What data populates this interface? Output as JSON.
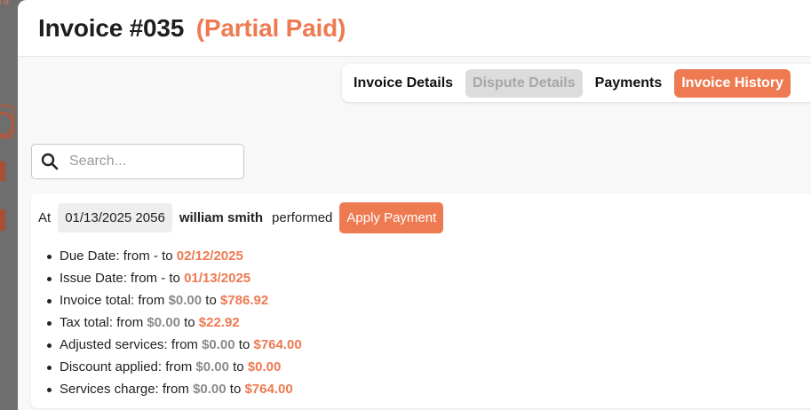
{
  "backdrop": {
    "fragment_text": "va"
  },
  "modal": {
    "title": "Invoice #035",
    "status": "(Partial Paid)"
  },
  "tabs": [
    {
      "label": "Invoice Details",
      "state": "normal"
    },
    {
      "label": "Dispute Details",
      "state": "disabled"
    },
    {
      "label": "Payments",
      "state": "normal"
    },
    {
      "label": "Invoice History",
      "state": "active"
    }
  ],
  "search": {
    "placeholder": "Search...",
    "value": "",
    "icon": "search-icon"
  },
  "history": {
    "entry": {
      "prefix": "At",
      "timestamp": "01/13/2025 2056",
      "user": "william smith",
      "verb": "performed",
      "action": "Apply Payment"
    },
    "changes": [
      {
        "field": "Due Date:",
        "from_word": "from",
        "from": "-",
        "to_word": "to",
        "to": "02/12/2025"
      },
      {
        "field": "Issue Date:",
        "from_word": "from",
        "from": "-",
        "to_word": "to",
        "to": "01/13/2025"
      },
      {
        "field": "Invoice total:",
        "from_word": "from",
        "from": "$0.00",
        "to_word": "to",
        "to": "$786.92"
      },
      {
        "field": "Tax total:",
        "from_word": "from",
        "from": "$0.00",
        "to_word": "to",
        "to": "$22.92"
      },
      {
        "field": "Adjusted services:",
        "from_word": "from",
        "from": "$0.00",
        "to_word": "to",
        "to": "$764.00"
      },
      {
        "field": "Discount applied:",
        "from_word": "from",
        "from": "$0.00",
        "to_word": "to",
        "to": "$0.00"
      },
      {
        "field": "Services charge:",
        "from_word": "from",
        "from": "$0.00",
        "to_word": "to",
        "to": "$764.00"
      }
    ]
  },
  "colors": {
    "accent": "#ee7a52",
    "muted": "#8a8a8a",
    "text": "#222222"
  }
}
